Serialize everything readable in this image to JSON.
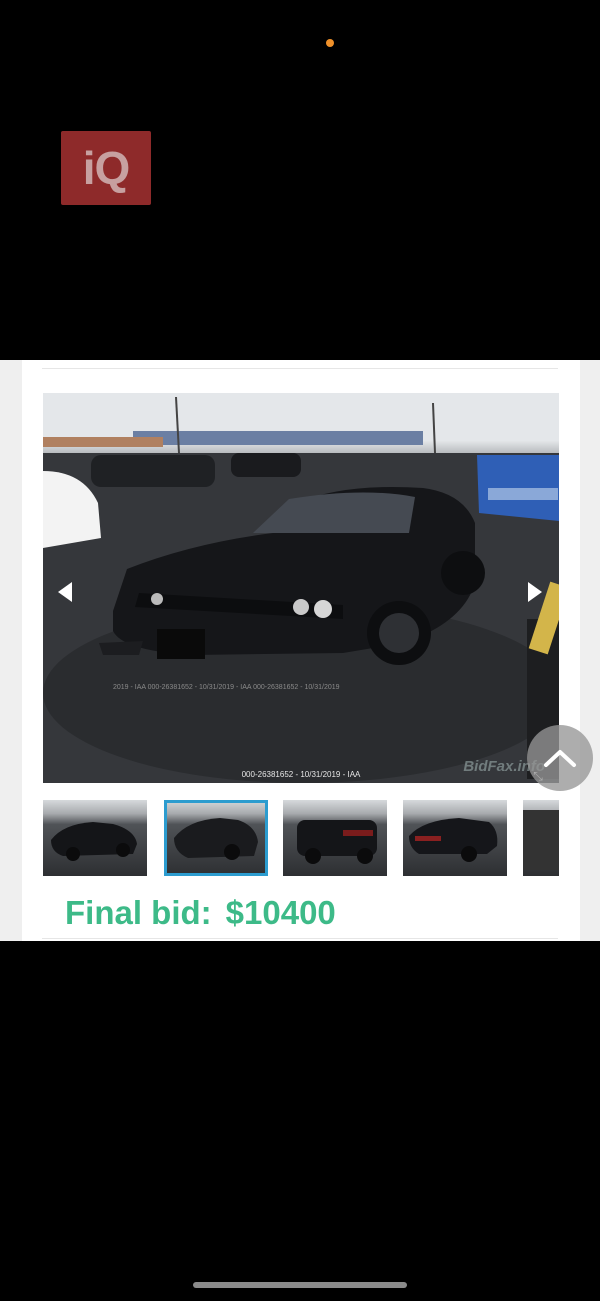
{
  "logo": {
    "text": "iQ"
  },
  "status": {
    "dot_color": "#f0912a"
  },
  "listing": {
    "photo_id_caption": "000-26381652 - 10/31/2019 - IAA",
    "photo_repeat_caption": "2019 - IAA      000-26381652 - 10/31/2019 - IAA      000-26381652 - 10/31/2019",
    "watermark_brand": "BidFax.info",
    "thumbnails": [
      {
        "active": false
      },
      {
        "active": true
      },
      {
        "active": false
      },
      {
        "active": false
      },
      {
        "active": false
      }
    ],
    "final_bid_label": "Final bid:",
    "final_bid_value": "$10400",
    "final_bid_color": "#3dba88"
  },
  "colors": {
    "background": "#000000",
    "card": "#ffffff",
    "thumb_active_border": "#2c9ccf"
  }
}
